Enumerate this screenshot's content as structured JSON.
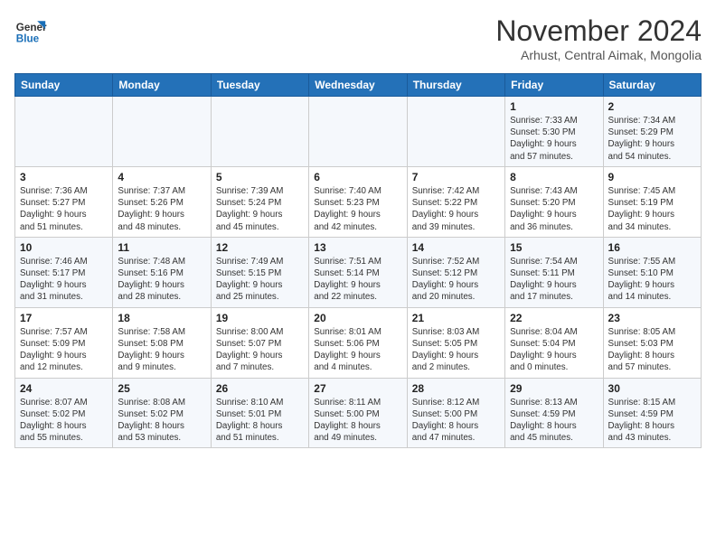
{
  "app": {
    "logo_line1": "General",
    "logo_line2": "Blue"
  },
  "title": "November 2024",
  "location": "Arhust, Central Aimak, Mongolia",
  "days_of_week": [
    "Sunday",
    "Monday",
    "Tuesday",
    "Wednesday",
    "Thursday",
    "Friday",
    "Saturday"
  ],
  "weeks": [
    {
      "days": [
        {
          "num": "",
          "info": ""
        },
        {
          "num": "",
          "info": ""
        },
        {
          "num": "",
          "info": ""
        },
        {
          "num": "",
          "info": ""
        },
        {
          "num": "",
          "info": ""
        },
        {
          "num": "1",
          "info": "Sunrise: 7:33 AM\nSunset: 5:30 PM\nDaylight: 9 hours\nand 57 minutes."
        },
        {
          "num": "2",
          "info": "Sunrise: 7:34 AM\nSunset: 5:29 PM\nDaylight: 9 hours\nand 54 minutes."
        }
      ]
    },
    {
      "days": [
        {
          "num": "3",
          "info": "Sunrise: 7:36 AM\nSunset: 5:27 PM\nDaylight: 9 hours\nand 51 minutes."
        },
        {
          "num": "4",
          "info": "Sunrise: 7:37 AM\nSunset: 5:26 PM\nDaylight: 9 hours\nand 48 minutes."
        },
        {
          "num": "5",
          "info": "Sunrise: 7:39 AM\nSunset: 5:24 PM\nDaylight: 9 hours\nand 45 minutes."
        },
        {
          "num": "6",
          "info": "Sunrise: 7:40 AM\nSunset: 5:23 PM\nDaylight: 9 hours\nand 42 minutes."
        },
        {
          "num": "7",
          "info": "Sunrise: 7:42 AM\nSunset: 5:22 PM\nDaylight: 9 hours\nand 39 minutes."
        },
        {
          "num": "8",
          "info": "Sunrise: 7:43 AM\nSunset: 5:20 PM\nDaylight: 9 hours\nand 36 minutes."
        },
        {
          "num": "9",
          "info": "Sunrise: 7:45 AM\nSunset: 5:19 PM\nDaylight: 9 hours\nand 34 minutes."
        }
      ]
    },
    {
      "days": [
        {
          "num": "10",
          "info": "Sunrise: 7:46 AM\nSunset: 5:17 PM\nDaylight: 9 hours\nand 31 minutes."
        },
        {
          "num": "11",
          "info": "Sunrise: 7:48 AM\nSunset: 5:16 PM\nDaylight: 9 hours\nand 28 minutes."
        },
        {
          "num": "12",
          "info": "Sunrise: 7:49 AM\nSunset: 5:15 PM\nDaylight: 9 hours\nand 25 minutes."
        },
        {
          "num": "13",
          "info": "Sunrise: 7:51 AM\nSunset: 5:14 PM\nDaylight: 9 hours\nand 22 minutes."
        },
        {
          "num": "14",
          "info": "Sunrise: 7:52 AM\nSunset: 5:12 PM\nDaylight: 9 hours\nand 20 minutes."
        },
        {
          "num": "15",
          "info": "Sunrise: 7:54 AM\nSunset: 5:11 PM\nDaylight: 9 hours\nand 17 minutes."
        },
        {
          "num": "16",
          "info": "Sunrise: 7:55 AM\nSunset: 5:10 PM\nDaylight: 9 hours\nand 14 minutes."
        }
      ]
    },
    {
      "days": [
        {
          "num": "17",
          "info": "Sunrise: 7:57 AM\nSunset: 5:09 PM\nDaylight: 9 hours\nand 12 minutes."
        },
        {
          "num": "18",
          "info": "Sunrise: 7:58 AM\nSunset: 5:08 PM\nDaylight: 9 hours\nand 9 minutes."
        },
        {
          "num": "19",
          "info": "Sunrise: 8:00 AM\nSunset: 5:07 PM\nDaylight: 9 hours\nand 7 minutes."
        },
        {
          "num": "20",
          "info": "Sunrise: 8:01 AM\nSunset: 5:06 PM\nDaylight: 9 hours\nand 4 minutes."
        },
        {
          "num": "21",
          "info": "Sunrise: 8:03 AM\nSunset: 5:05 PM\nDaylight: 9 hours\nand 2 minutes."
        },
        {
          "num": "22",
          "info": "Sunrise: 8:04 AM\nSunset: 5:04 PM\nDaylight: 9 hours\nand 0 minutes."
        },
        {
          "num": "23",
          "info": "Sunrise: 8:05 AM\nSunset: 5:03 PM\nDaylight: 8 hours\nand 57 minutes."
        }
      ]
    },
    {
      "days": [
        {
          "num": "24",
          "info": "Sunrise: 8:07 AM\nSunset: 5:02 PM\nDaylight: 8 hours\nand 55 minutes."
        },
        {
          "num": "25",
          "info": "Sunrise: 8:08 AM\nSunset: 5:02 PM\nDaylight: 8 hours\nand 53 minutes."
        },
        {
          "num": "26",
          "info": "Sunrise: 8:10 AM\nSunset: 5:01 PM\nDaylight: 8 hours\nand 51 minutes."
        },
        {
          "num": "27",
          "info": "Sunrise: 8:11 AM\nSunset: 5:00 PM\nDaylight: 8 hours\nand 49 minutes."
        },
        {
          "num": "28",
          "info": "Sunrise: 8:12 AM\nSunset: 5:00 PM\nDaylight: 8 hours\nand 47 minutes."
        },
        {
          "num": "29",
          "info": "Sunrise: 8:13 AM\nSunset: 4:59 PM\nDaylight: 8 hours\nand 45 minutes."
        },
        {
          "num": "30",
          "info": "Sunrise: 8:15 AM\nSunset: 4:59 PM\nDaylight: 8 hours\nand 43 minutes."
        }
      ]
    }
  ]
}
